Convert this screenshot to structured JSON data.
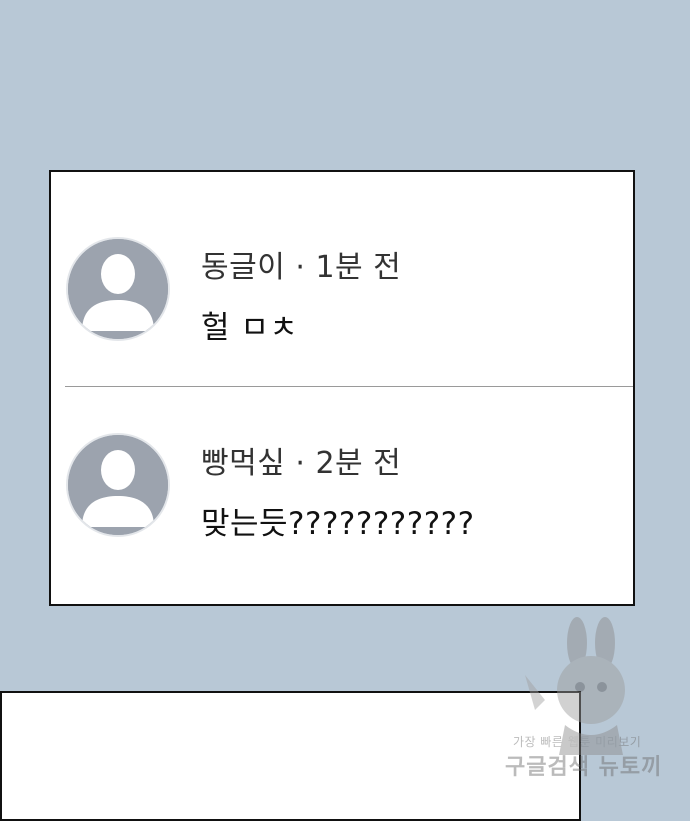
{
  "comments": [
    {
      "author": "동글이",
      "separator": "·",
      "time": "1분 전",
      "text": "헐 ㅁㅊ",
      "avatar_icon": "default-user-avatar-icon"
    },
    {
      "author": "빵먹싶",
      "separator": "·",
      "time": "2분 전",
      "text": "맞는듯???????????",
      "avatar_icon": "default-user-avatar-icon"
    }
  ],
  "watermark": {
    "line1": "가장 빠른 웹툰 미리보기",
    "line2": "구글검색 뉴토끼"
  },
  "colors": {
    "background": "#b8c8d6",
    "card": "#ffffff",
    "card_border": "#111111",
    "avatar": "#9ca3ae",
    "divider": "#9a9a9a"
  }
}
